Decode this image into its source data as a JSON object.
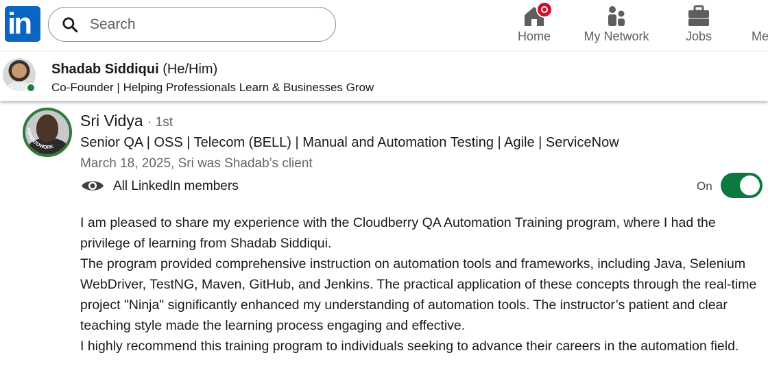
{
  "nav": {
    "logo_text": "in",
    "search_placeholder": "Search",
    "items": [
      {
        "label": "Home",
        "icon": "home-icon",
        "has_badge": true
      },
      {
        "label": "My Network",
        "icon": "my-network-icon"
      },
      {
        "label": "Jobs",
        "icon": "jobs-icon"
      },
      {
        "label": "Me",
        "icon": "me-icon"
      }
    ],
    "colors": {
      "brand": "#0a66c2",
      "badge": "#cb112d"
    }
  },
  "profile_bar": {
    "name": "Shadab Siddiqui",
    "pronouns": "(He/Him)",
    "headline": "Co-Founder | Helping Professionals Learn & Businesses Grow",
    "online_status_color": "#1f7d3f"
  },
  "recommendation": {
    "name": "Sri Vidya",
    "degree": "· 1st",
    "headline": "Senior QA | OSS | Telecom (BELL) | Manual and Automation Testing | Agile | ServiceNow",
    "meta": "March 18, 2025, Sri was Shadab’s client",
    "avatar_frame_text": "#OPENTOWORK",
    "visibility_label": "All LinkedIn members",
    "toggle_label": "On",
    "toggle_on": true,
    "toggle_color": "#0a7a3f",
    "body": [
      "I am pleased to share my experience with the Cloudberry QA Automation Training program, where I had the privilege of learning from Shadab Siddiqui.",
      "The program provided comprehensive instruction on automation tools and frameworks, including Java, Selenium WebDriver, TestNG, Maven, GitHub, and Jenkins. The practical application of these concepts through the real-time project \"Ninja\" significantly enhanced my understanding of automation tools. The instructor’s patient and clear teaching style made the learning process engaging and effective.",
      "I highly recommend this training program to individuals seeking to advance their careers in the automation field."
    ]
  }
}
